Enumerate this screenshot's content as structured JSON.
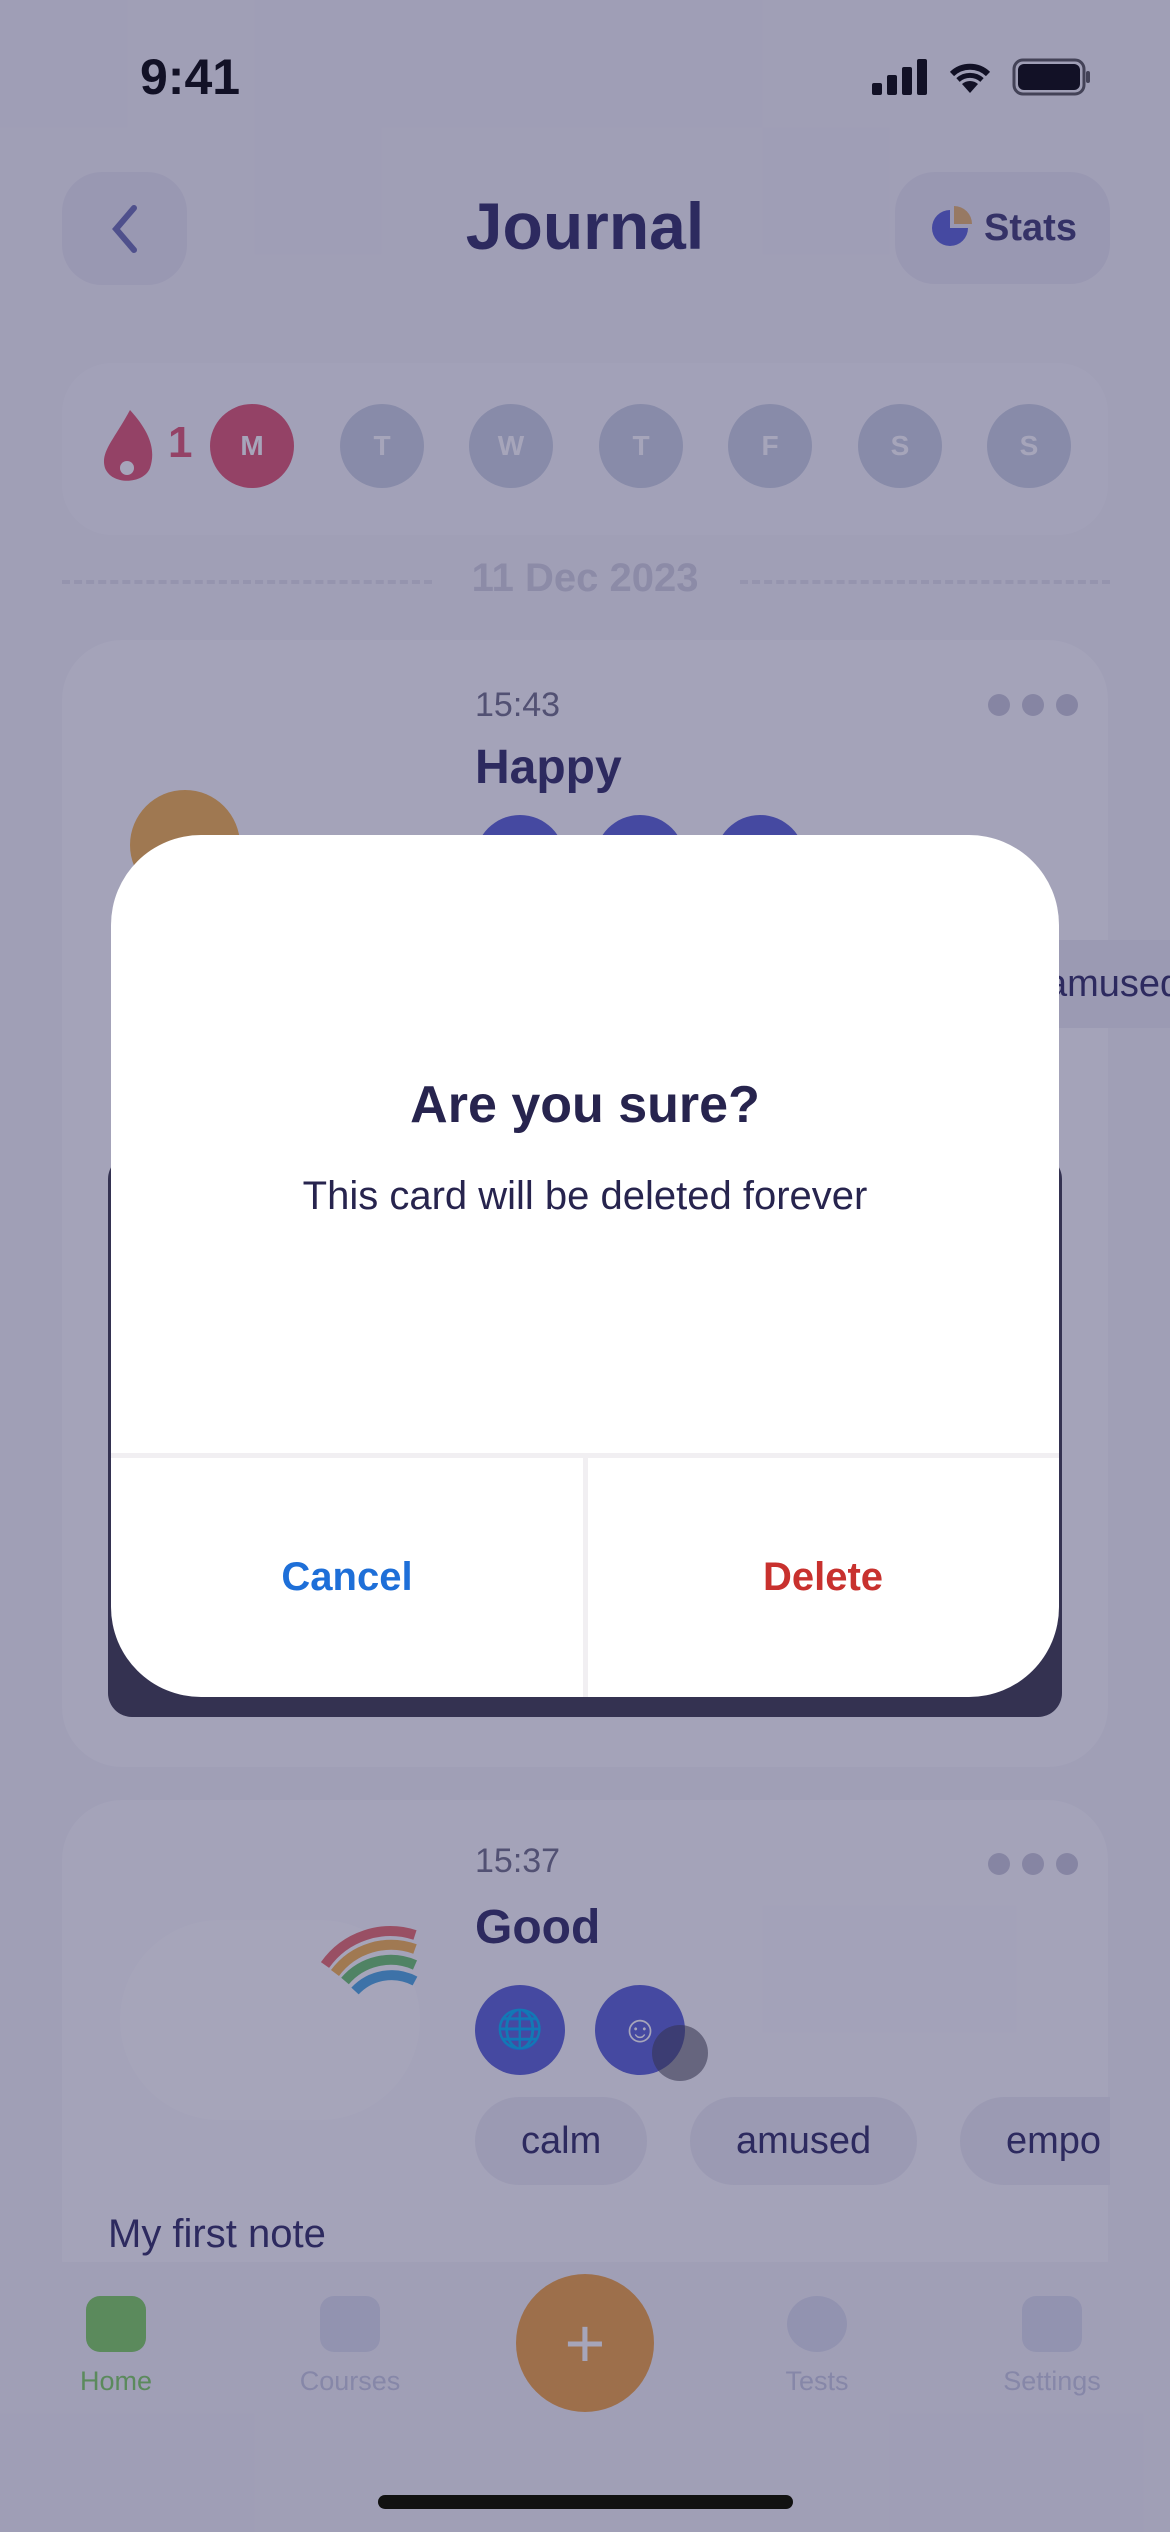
{
  "status_bar": {
    "time": "9:41"
  },
  "header": {
    "title": "Journal",
    "stats_label": "Stats"
  },
  "streak": {
    "count": "1",
    "days": [
      "M",
      "T",
      "W",
      "T",
      "F",
      "S",
      "S"
    ],
    "active_index": 0
  },
  "date_separator": "11 Dec 2023",
  "entries": [
    {
      "time": "15:43",
      "mood": "Happy",
      "chips": [
        "amused"
      ]
    },
    {
      "time": "15:37",
      "mood": "Good",
      "chips": [
        "calm",
        "amused",
        "empo"
      ],
      "note_title": "My first note"
    }
  ],
  "tabs": [
    {
      "label": "Home",
      "active": true
    },
    {
      "label": "Courses"
    },
    {
      "label": "Tests"
    },
    {
      "label": "Settings"
    }
  ],
  "dialog": {
    "title": "Are you sure?",
    "message": "This card will be deleted forever",
    "cancel_label": "Cancel",
    "delete_label": "Delete"
  },
  "colors": {
    "accent": "#5961d4",
    "streak": "#e0556f",
    "add_button": "#f0a340",
    "home_active": "#7fd05e",
    "cancel": "#1e6fd8",
    "delete": "#c8312e"
  }
}
